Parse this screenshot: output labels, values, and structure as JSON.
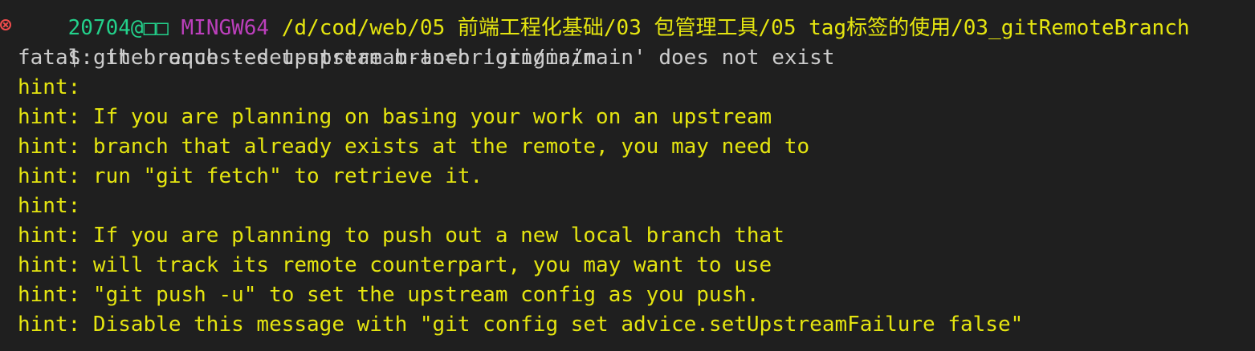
{
  "terminal": {
    "prompt_header": {
      "user_host": "20704@",
      "host_glyphs": "□□",
      "system": "MINGW64",
      "path": "/d/cod/web/05 前端工程化基础/03 包管理工具/05 tag标签的使用/03_gitRemoteBranch"
    },
    "command": {
      "prompt": "$",
      "text": "git branch --set-upstream-to=origin/main"
    },
    "output": [
      {
        "type": "fatal",
        "text": "fatal: the requested upstream branch 'origin/main' does not exist"
      },
      {
        "type": "hint",
        "text": "hint:"
      },
      {
        "type": "hint",
        "text": "hint: If you are planning on basing your work on an upstream"
      },
      {
        "type": "hint",
        "text": "hint: branch that already exists at the remote, you may need to"
      },
      {
        "type": "hint",
        "text": "hint: run \"git fetch\" to retrieve it."
      },
      {
        "type": "hint",
        "text": "hint:"
      },
      {
        "type": "hint",
        "text": "hint: If you are planning to push out a new local branch that"
      },
      {
        "type": "hint",
        "text": "hint: will track its remote counterpart, you may want to use"
      },
      {
        "type": "hint",
        "text": "hint: \"git push -u\" to set the upstream config as you push."
      },
      {
        "type": "hint",
        "text": "hint: Disable this message with \"git config set advice.setUpstreamFailure false\""
      }
    ],
    "colors": {
      "background": "#1f1f1f",
      "text": "#cccccc",
      "hint": "#e5e510",
      "user": "#23d18b",
      "host": "#bc3fbc",
      "error": "#f14c4c"
    }
  }
}
